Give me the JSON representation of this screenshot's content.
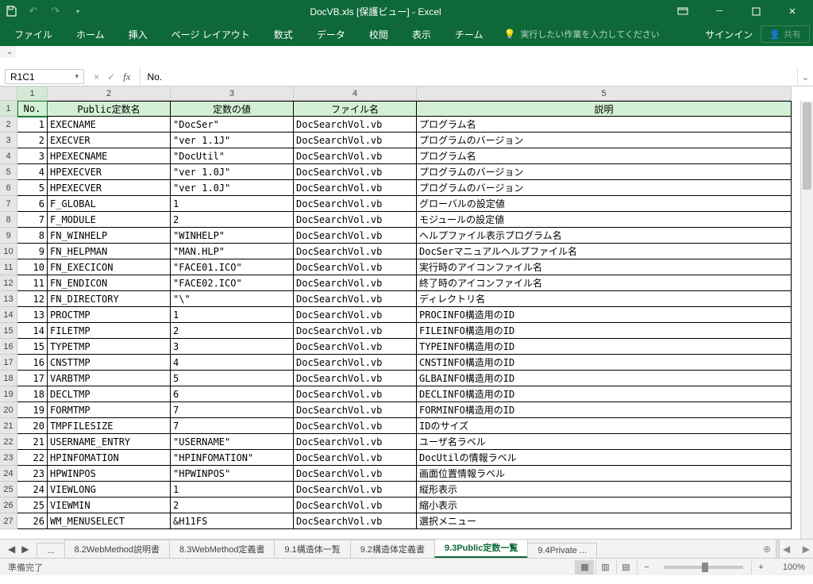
{
  "title": "DocVB.xls [保護ビュー] - Excel",
  "ribbon": {
    "tabs": [
      "ファイル",
      "ホーム",
      "挿入",
      "ページ レイアウト",
      "数式",
      "データ",
      "校閲",
      "表示",
      "チーム"
    ],
    "tellme": "実行したい作業を入力してください",
    "signin": "サインイン",
    "share": "共有"
  },
  "formula_bar": {
    "namebox": "R1C1",
    "formula": "No."
  },
  "columns": [
    {
      "num": "1",
      "w": "c1"
    },
    {
      "num": "2",
      "w": "c2"
    },
    {
      "num": "3",
      "w": "c3"
    },
    {
      "num": "4",
      "w": "c4"
    },
    {
      "num": "5",
      "w": "c5"
    }
  ],
  "headers": [
    "No.",
    "Public定数名",
    "定数の値",
    "ファイル名",
    "説明"
  ],
  "rows": [
    {
      "n": "1",
      "a": "EXECNAME",
      "b": "\"DocSer\"",
      "c": "DocSearchVol.vb",
      "d": "プログラム名"
    },
    {
      "n": "2",
      "a": "EXECVER",
      "b": "\"ver 1.1J\"",
      "c": "DocSearchVol.vb",
      "d": "プログラムのバージョン"
    },
    {
      "n": "3",
      "a": "HPEXECNAME",
      "b": "\"DocUtil\"",
      "c": "DocSearchVol.vb",
      "d": "プログラム名"
    },
    {
      "n": "4",
      "a": "HPEXECVER",
      "b": "\"ver 1.0J\"",
      "c": "DocSearchVol.vb",
      "d": "プログラムのバージョン"
    },
    {
      "n": "5",
      "a": "HPEXECVER",
      "b": "\"ver 1.0J\"",
      "c": "DocSearchVol.vb",
      "d": "プログラムのバージョン"
    },
    {
      "n": "6",
      "a": "F_GLOBAL",
      "b": "1",
      "c": "DocSearchVol.vb",
      "d": "グローバルの設定値"
    },
    {
      "n": "7",
      "a": "F_MODULE",
      "b": "2",
      "c": "DocSearchVol.vb",
      "d": "モジュールの設定値"
    },
    {
      "n": "8",
      "a": "FN_WINHELP",
      "b": "\"WINHELP\"",
      "c": "DocSearchVol.vb",
      "d": "ヘルプファイル表示プログラム名"
    },
    {
      "n": "9",
      "a": "FN_HELPMAN",
      "b": "\"MAN.HLP\"",
      "c": "DocSearchVol.vb",
      "d": "DocSerマニュアルヘルプファイル名"
    },
    {
      "n": "10",
      "a": "FN_EXECICON",
      "b": "\"FACE01.ICO\"",
      "c": "DocSearchVol.vb",
      "d": "実行時のアイコンファイル名"
    },
    {
      "n": "11",
      "a": "FN_ENDICON",
      "b": "\"FACE02.ICO\"",
      "c": "DocSearchVol.vb",
      "d": "終了時のアイコンファイル名"
    },
    {
      "n": "12",
      "a": "FN_DIRECTORY",
      "b": "\"\\\"",
      "c": "DocSearchVol.vb",
      "d": "ディレクトリ名"
    },
    {
      "n": "13",
      "a": "PROCTMP",
      "b": "1",
      "c": "DocSearchVol.vb",
      "d": "PROCINFO構造用のID"
    },
    {
      "n": "14",
      "a": "FILETMP",
      "b": "2",
      "c": "DocSearchVol.vb",
      "d": "FILEINFO構造用のID"
    },
    {
      "n": "15",
      "a": "TYPETMP",
      "b": "3",
      "c": "DocSearchVol.vb",
      "d": "TYPEINFO構造用のID"
    },
    {
      "n": "16",
      "a": "CNSTTMP",
      "b": "4",
      "c": "DocSearchVol.vb",
      "d": "CNSTINFO構造用のID"
    },
    {
      "n": "17",
      "a": "VARBTMP",
      "b": "5",
      "c": "DocSearchVol.vb",
      "d": "GLBAINFO構造用のID"
    },
    {
      "n": "18",
      "a": "DECLTMP",
      "b": "6",
      "c": "DocSearchVol.vb",
      "d": "DECLINFO構造用のID"
    },
    {
      "n": "19",
      "a": "FORMTMP",
      "b": "7",
      "c": "DocSearchVol.vb",
      "d": "FORMINFO構造用のID"
    },
    {
      "n": "20",
      "a": "TMPFILESIZE",
      "b": "7",
      "c": "DocSearchVol.vb",
      "d": "IDのサイズ"
    },
    {
      "n": "21",
      "a": "USERNAME_ENTRY",
      "b": "\"USERNAME\"",
      "c": "DocSearchVol.vb",
      "d": "ユーザ名ラベル"
    },
    {
      "n": "22",
      "a": "HPINFOMATION",
      "b": "\"HPINFOMATION\"",
      "c": "DocSearchVol.vb",
      "d": "DocUtilの情報ラベル"
    },
    {
      "n": "23",
      "a": "HPWINPOS",
      "b": "\"HPWINPOS\"",
      "c": "DocSearchVol.vb",
      "d": "画面位置情報ラベル"
    },
    {
      "n": "24",
      "a": "VIEWLONG",
      "b": "1",
      "c": "DocSearchVol.vb",
      "d": "縦形表示"
    },
    {
      "n": "25",
      "a": "VIEWMIN",
      "b": "2",
      "c": "DocSearchVol.vb",
      "d": "縮小表示"
    },
    {
      "n": "26",
      "a": "WM_MENUSELECT",
      "b": "&H11FS",
      "c": "DocSearchVol.vb",
      "d": "選択メニュー"
    }
  ],
  "sheets": {
    "overflow": "...",
    "tabs": [
      "8.2WebMethod説明書",
      "8.3WebMethod定義書",
      "9.1構造体一覧",
      "9.2構造体定義書",
      "9.3Public定数一覧",
      "9.4Private"
    ],
    "active_index": 4,
    "last_overflow": "..."
  },
  "status": {
    "ready": "準備完了",
    "zoom": "100%"
  }
}
